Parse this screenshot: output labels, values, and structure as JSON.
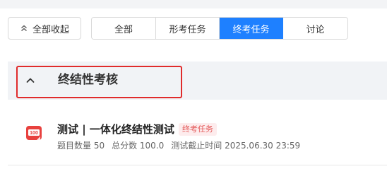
{
  "toolbar": {
    "collapse_all_label": "全部收起"
  },
  "tabs": [
    {
      "label": "全部",
      "active": false
    },
    {
      "label": "形考任务",
      "active": false
    },
    {
      "label": "终考任务",
      "active": true
    },
    {
      "label": "讨论",
      "active": false
    }
  ],
  "section": {
    "title": "终结性考核"
  },
  "task": {
    "title": "测试 | 一体化终结性测试",
    "badge": "终考任务",
    "icon_text": "100",
    "question_count": "题目数量 50",
    "total_score": "总分数 100.0",
    "deadline": "测试截止时间 2025.06.30 23:59"
  },
  "colors": {
    "accent": "#1e80ff",
    "highlight_border": "#e02b2b",
    "badge_text": "#e45a5a",
    "badge_bg": "#fdeced",
    "icon_red": "#e8413e"
  }
}
